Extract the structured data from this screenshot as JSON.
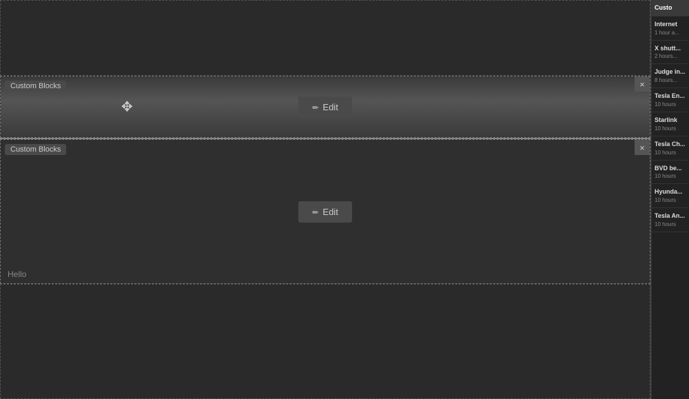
{
  "blocks": {
    "label": "Custom Blocks",
    "edit_button": "Edit",
    "hello_text": "Hello"
  },
  "sidebar": {
    "top_item": {
      "title": "Custo",
      "time": ""
    },
    "items": [
      {
        "title": "Internet",
        "time": "1 hour a..."
      },
      {
        "title": "X shutt...",
        "time": "2 hours..."
      },
      {
        "title": "Judge in...",
        "time": "8 hours..."
      },
      {
        "title": "Tesla En...",
        "time": "10 hours"
      },
      {
        "title": "Starlink",
        "time": "10 hours"
      },
      {
        "title": "Tesla Ch...",
        "time": "10 hours"
      },
      {
        "title": "BVD be...",
        "time": "10 hours"
      },
      {
        "title": "Hyunda...",
        "time": "10 hours"
      },
      {
        "title": "Tesla An...",
        "time": "10 hours"
      }
    ]
  }
}
